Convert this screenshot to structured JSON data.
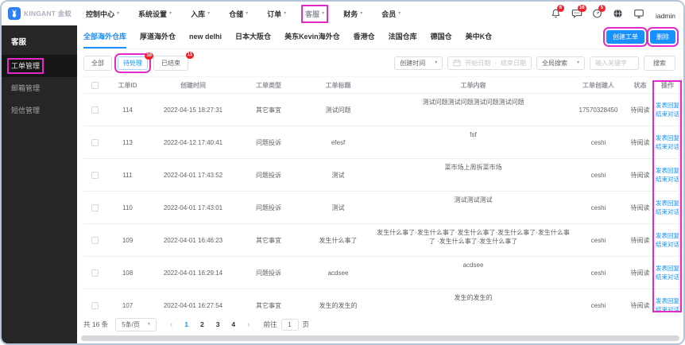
{
  "colors": {
    "accent": "#1890ff",
    "annotation": "#e32ac9",
    "badge": "#f5222d",
    "sidebar_bg": "#262626"
  },
  "topnav": {
    "logo_text": "KINGANT 金蚁",
    "items": [
      {
        "key": "control-center",
        "label": "控制中心"
      },
      {
        "key": "system-settings",
        "label": "系统设置"
      },
      {
        "key": "inbound",
        "label": "入库"
      },
      {
        "key": "warehouse",
        "label": "仓储"
      },
      {
        "key": "orders",
        "label": "订单"
      },
      {
        "key": "customer-service",
        "label": "客服",
        "highlighted": true
      },
      {
        "key": "finance",
        "label": "财务"
      },
      {
        "key": "member",
        "label": "会员"
      }
    ],
    "badges": {
      "bell": "6",
      "chat": "16",
      "dashboard": "5"
    },
    "username": "iadmin"
  },
  "sidebar": {
    "title": "客服",
    "items": [
      {
        "key": "work-order-management",
        "label": "工单管理",
        "active": true,
        "annotated": true
      },
      {
        "key": "mailbox-management",
        "label": "邮箱管理"
      },
      {
        "key": "sms-management",
        "label": "短信管理"
      }
    ]
  },
  "tabs": [
    {
      "key": "all-overseas-warehouses",
      "label": "全部海外仓库",
      "active": true
    },
    {
      "key": "houdao-overseas",
      "label": "厚道海外仓"
    },
    {
      "key": "new-delhi",
      "label": "new delhi"
    },
    {
      "key": "japan-osaka",
      "label": "日本大阪仓"
    },
    {
      "key": "us-east-kevin",
      "label": "美东Kevin海外仓"
    },
    {
      "key": "hongkong",
      "label": "香港仓"
    },
    {
      "key": "france",
      "label": "法国仓库"
    },
    {
      "key": "germany",
      "label": "德国仓"
    },
    {
      "key": "us-china-k",
      "label": "美中K仓"
    }
  ],
  "toolbar": {
    "create_label": "创建工单",
    "delete_label": "删除"
  },
  "filters": [
    {
      "key": "all",
      "label": "全部"
    },
    {
      "key": "pending",
      "label": "待处理",
      "badge": "10",
      "selected": true,
      "annotated": true
    },
    {
      "key": "finished",
      "label": "已结束",
      "badge": "11"
    }
  ],
  "search": {
    "time_field": "创建时间",
    "start_placeholder": "开始日期",
    "range_separator": "-",
    "end_placeholder": "结束日期",
    "scope_field": "全局搜索",
    "keyword_placeholder": "输入关键字",
    "button_label": "搜索"
  },
  "table": {
    "headers": [
      "工单ID",
      "创建时间",
      "工单类型",
      "工单标题",
      "工单内容",
      "工单创建人",
      "状态",
      "操作"
    ],
    "row_actions": [
      {
        "key": "post-reply",
        "label": "发表回复"
      },
      {
        "key": "end-conversation",
        "label": "结束对话"
      }
    ],
    "rows": [
      {
        "id": "114",
        "created": "2022-04-15 18:27:31",
        "type": "其它事宜",
        "title": "测试问题",
        "content": "测试问题测试问题测试问题测试问题",
        "creator": "17570328450",
        "status": "待阅读"
      },
      {
        "id": "113",
        "created": "2022-04-12 17:40:41",
        "type": "问题投诉",
        "title": "efesf",
        "content": "fsf",
        "creator": "ceshi",
        "status": "待阅读"
      },
      {
        "id": "111",
        "created": "2022-04-01 17:43:52",
        "type": "问题投诉",
        "title": "测试",
        "content": "菜市场上周拆菜市场",
        "creator": "ceshi",
        "status": "待阅读"
      },
      {
        "id": "110",
        "created": "2022-04-01 17:43:01",
        "type": "问题投诉",
        "title": "测试",
        "content": "测试测试测试",
        "creator": "ceshi",
        "status": "待阅读"
      },
      {
        "id": "109",
        "created": "2022-04-01 16:46:23",
        "type": "其它事宜",
        "title": "发生什么事了",
        "content": "发生什么事了·发生什么事了·发生什么事了·发生什么事了·发生什么事了 ·发生什么事了·发生什么事了",
        "creator": "ceshi",
        "status": "待阅读"
      },
      {
        "id": "108",
        "created": "2022-04-01 16:29:14",
        "type": "问题投诉",
        "title": "acdsee",
        "content": "acdsee",
        "creator": "ceshi",
        "status": "待阅读"
      },
      {
        "id": "107",
        "created": "2022-04-01 16:27:54",
        "type": "其它事宜",
        "title": "发生的发生的",
        "content": "发生的发生的",
        "creator": "ceshi",
        "status": "待阅读"
      }
    ]
  },
  "pagination": {
    "total": "共 16 条",
    "per_page": "5条/页",
    "prev": "‹",
    "pages": [
      "1",
      "2",
      "3",
      "4"
    ],
    "current": "1",
    "next": "›",
    "goto_label": "前往",
    "goto_value": "1",
    "goto_unit": "页"
  }
}
